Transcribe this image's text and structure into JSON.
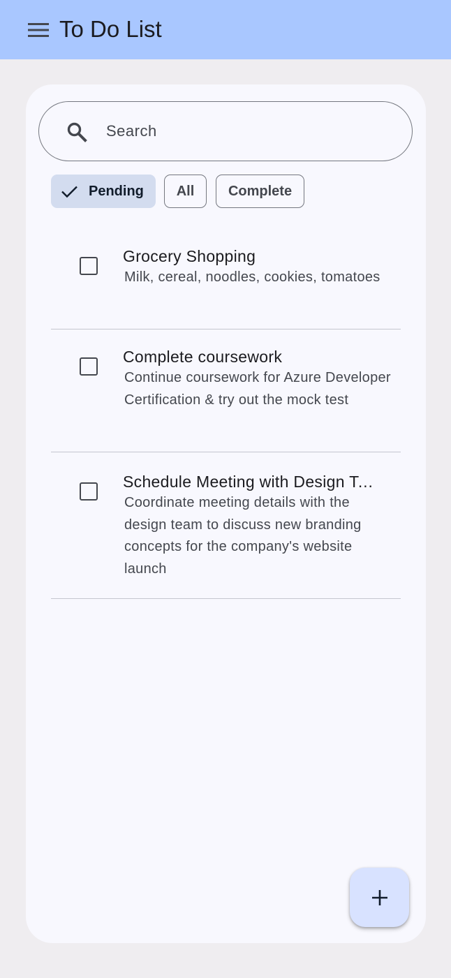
{
  "app_bar": {
    "title": "To Do List",
    "menu_icon": "menu-icon",
    "background": "#a9c7ff"
  },
  "search": {
    "placeholder": "Search",
    "value": "",
    "icon": "search-icon"
  },
  "filters": {
    "pending_label": "Pending",
    "all_label": "All",
    "complete_label": "Complete",
    "selected": "Pending",
    "selected_icon": "check-icon"
  },
  "todos": [
    {
      "title": "Grocery Shopping",
      "description": "Milk, cereal, noodles, cookies, tomatoes",
      "checked": false
    },
    {
      "title": "Complete coursework",
      "description": "Continue coursework for Azure Developer Certification & try out the mock test",
      "checked": false
    },
    {
      "title": "Schedule Meeting with Design Team",
      "description": "Coordinate meeting details with the design team to discuss new branding concepts for the company's website launch",
      "checked": false
    }
  ],
  "fab": {
    "icon": "plus-icon",
    "color": "#d8e2ff"
  }
}
